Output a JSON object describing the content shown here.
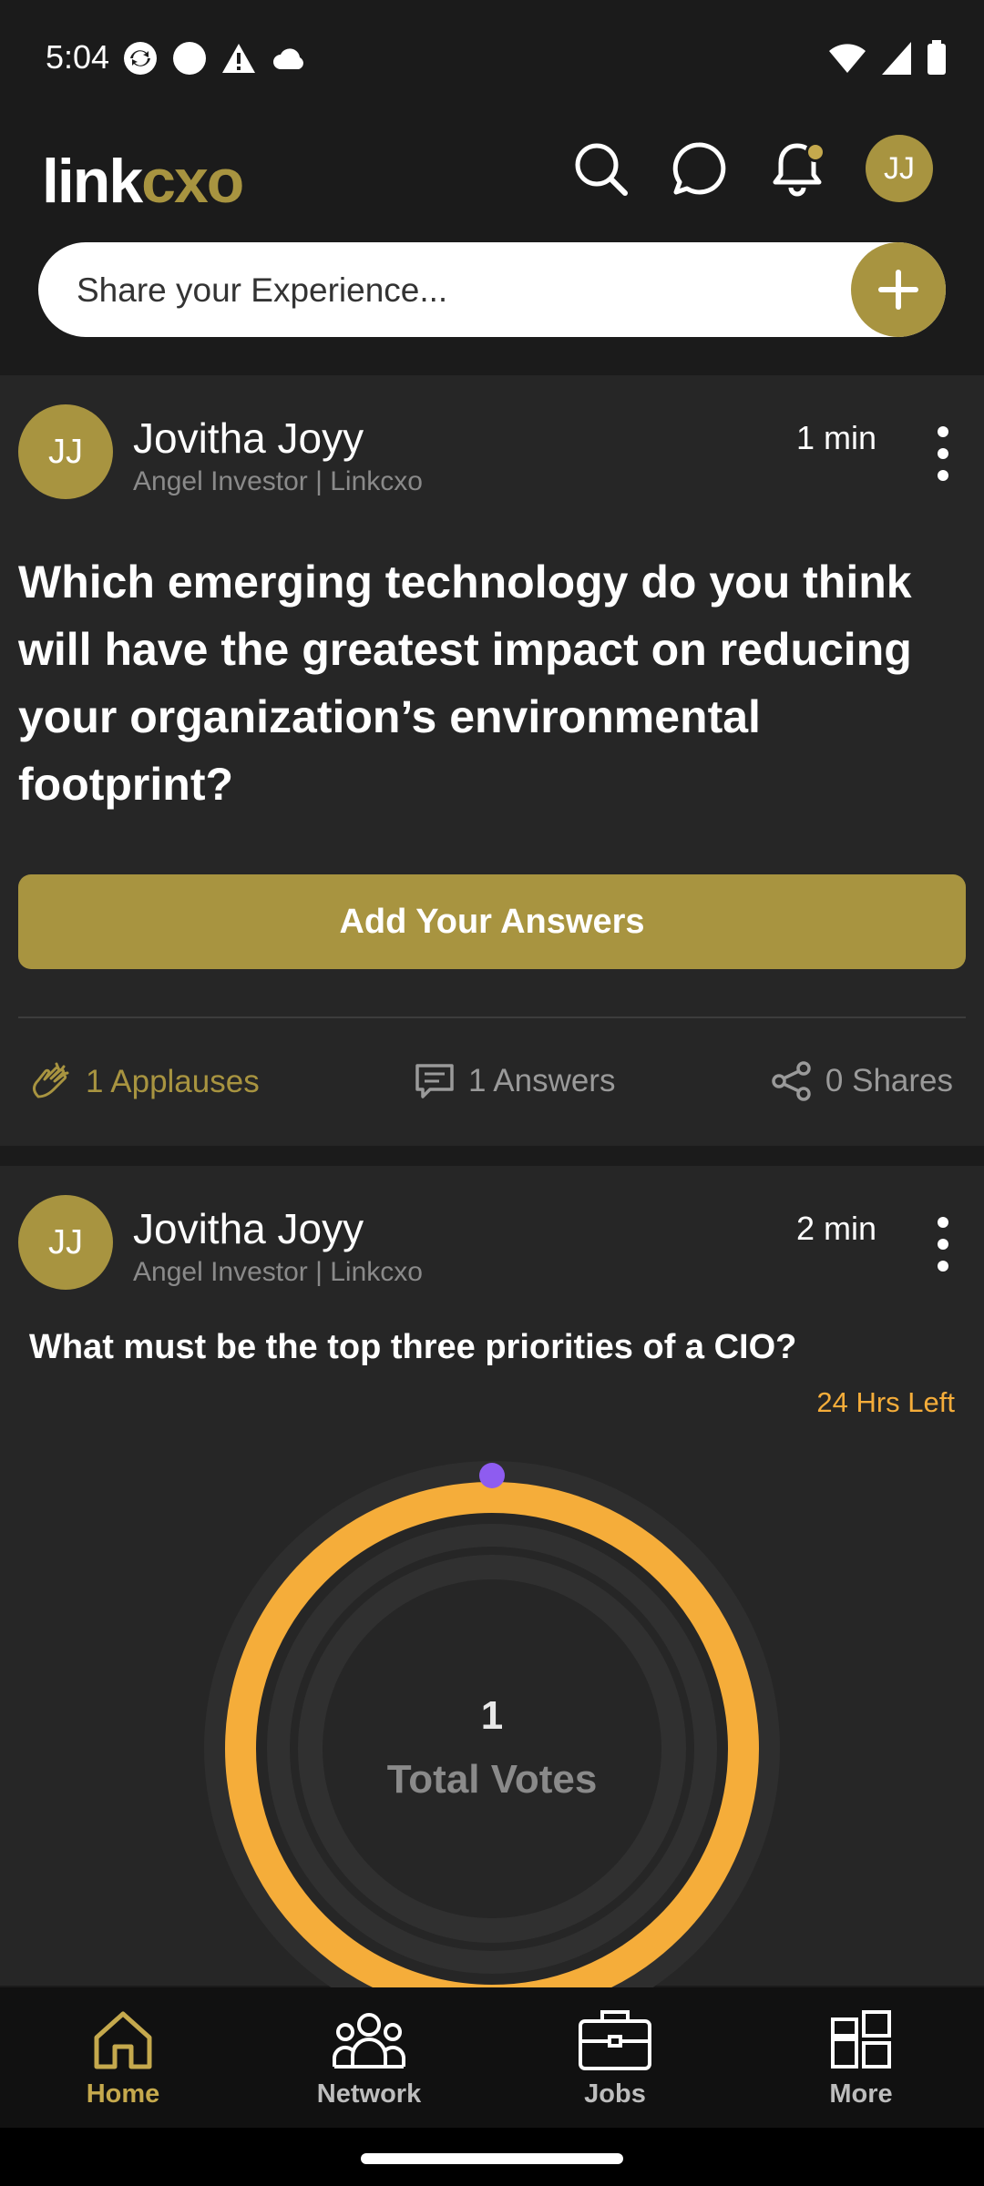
{
  "status_bar": {
    "time": "5:04"
  },
  "header": {
    "logo_link": "link",
    "logo_cxo": "cxo",
    "avatar_initials": "JJ",
    "share_placeholder": "Share your Experience..."
  },
  "posts": [
    {
      "avatar": "JJ",
      "name": "Jovitha Joyy",
      "subtitle": "Angel Investor | Linkcxo",
      "time": "1 min",
      "question": "Which emerging technology do you think will have the greatest impact on reducing your organization’s environmental footprint?",
      "answer_button": "Add Your Answers",
      "applauses": "1 Applauses",
      "answers": "1 Answers",
      "shares": "0 Shares"
    },
    {
      "avatar": "JJ",
      "name": "Jovitha Joyy",
      "subtitle": "Angel Investor | Linkcxo",
      "time": "2 min",
      "question": "What must be the top three priorities of a CIO?",
      "time_left": "24 Hrs Left",
      "total_votes_value": "1",
      "total_votes_label": "Total Votes"
    }
  ],
  "bottom_nav": [
    {
      "label": "Home",
      "active": true
    },
    {
      "label": "Network",
      "active": false
    },
    {
      "label": "Jobs",
      "active": false
    },
    {
      "label": "More",
      "active": false
    }
  ],
  "colors": {
    "accent": "#a89440",
    "poll_ring": "#f5ad3a",
    "poll_dot": "#8e5cf0",
    "card_bg": "#262626",
    "page_bg": "#1b1b1b"
  }
}
